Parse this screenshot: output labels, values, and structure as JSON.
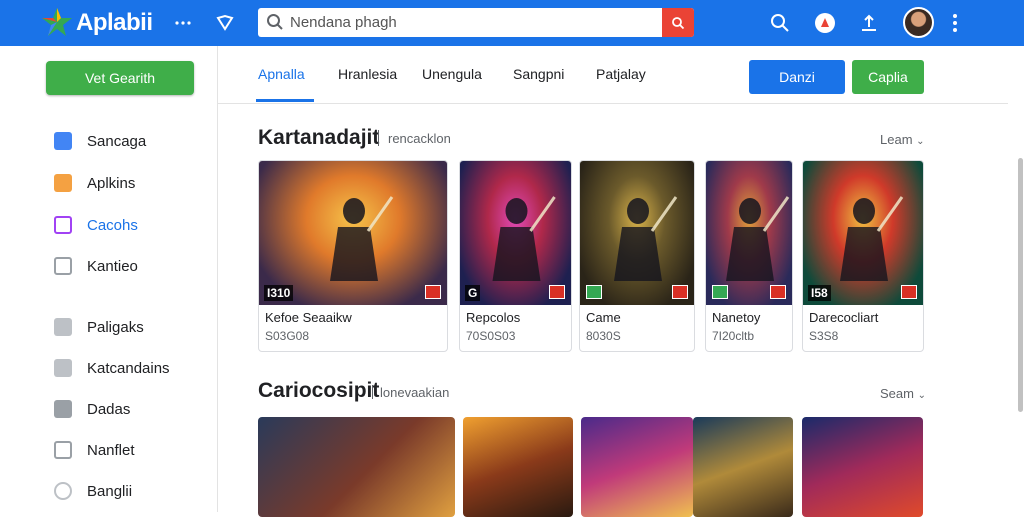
{
  "app": {
    "brand": "Aplabii"
  },
  "search": {
    "value": "Nendana phagh"
  },
  "sidebar": {
    "cta_label": "Vet Gearith",
    "items": [
      {
        "label": "Sancaga",
        "color": "#4285f4",
        "active": false
      },
      {
        "label": "Aplkins",
        "color": "#f4a142",
        "active": false
      },
      {
        "label": "Cacohs",
        "color": "#a142f4",
        "active": true
      },
      {
        "label": "Kantieo",
        "color": "#9aa0a6",
        "active": false
      },
      {
        "label": "Paligaks",
        "color": "#bdc1c6",
        "active": false
      },
      {
        "label": "Katcandains",
        "color": "#bdc1c6",
        "active": false
      },
      {
        "label": "Dadas",
        "color": "#9aa0a6",
        "active": false
      },
      {
        "label": "Nanflet",
        "color": "#9aa0a6",
        "active": false
      },
      {
        "label": "Banglii",
        "color": "#bdc1c6",
        "active": false
      }
    ]
  },
  "tabs": [
    {
      "label": "Apnalla",
      "active": true
    },
    {
      "label": "Hranlesia",
      "active": false
    },
    {
      "label": "Unengula",
      "active": false
    },
    {
      "label": "Sangpni",
      "active": false
    },
    {
      "label": "Patjalay",
      "active": false
    }
  ],
  "header_buttons": {
    "primary": "Danzi",
    "secondary": "Caplia"
  },
  "sections": [
    {
      "title": "Kartanadajit",
      "subtitle": "rencacklon",
      "more": "Leam",
      "cards": [
        {
          "title": "Kefoe Seaaikw",
          "meta": "S03G08",
          "badge": "I310",
          "art": [
            "#3b2a4a",
            "#e07a2b",
            "#f6c34a"
          ]
        },
        {
          "title": "Repcolos",
          "meta": "70S0S03",
          "badge": "G",
          "art": [
            "#1e2050",
            "#b0284a",
            "#e04ab8"
          ]
        },
        {
          "title": "Came",
          "meta": "8030S",
          "badge": "",
          "art": [
            "#2a2418",
            "#6b5a2b",
            "#d8b24a"
          ]
        },
        {
          "title": "Nanetoy",
          "meta": "7I20cltb",
          "badge": "",
          "art": [
            "#2a2a5a",
            "#a03a4a",
            "#e0a03a"
          ]
        },
        {
          "title": "Darecocliart",
          "meta": "S3S8",
          "badge": "I58",
          "art": [
            "#0e4a3a",
            "#d03a2a",
            "#f0c040"
          ]
        }
      ]
    },
    {
      "title": "Cariocosipit",
      "subtitle": "lonevaakian",
      "more": "Seam"
    }
  ]
}
